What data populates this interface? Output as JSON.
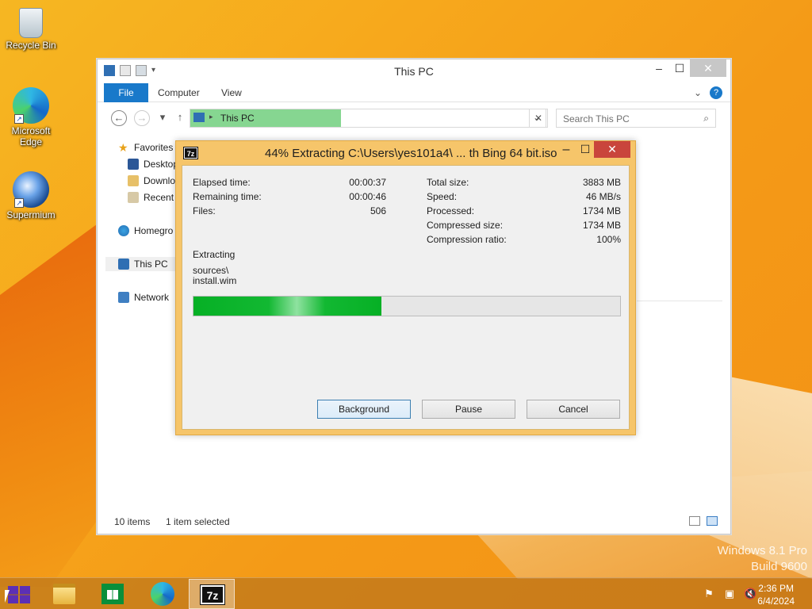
{
  "desktop": {
    "icons": [
      {
        "label": "Recycle Bin",
        "icon": "recycle-bin-icon"
      },
      {
        "label": "Microsoft Edge",
        "icon": "edge-icon"
      },
      {
        "label": "Supermium",
        "icon": "supermium-icon"
      }
    ],
    "watermark": {
      "line1": "Windows 8.1 Pro",
      "line2": "Build 9600"
    }
  },
  "explorer": {
    "title": "This PC",
    "tabs": {
      "file": "File",
      "computer": "Computer",
      "view": "View"
    },
    "address": "This PC",
    "search_placeholder": "Search This PC",
    "nav": {
      "favorites": "Favorites",
      "desktop": "Desktop",
      "downloads": "Downlo",
      "recent": "Recent p",
      "homegroup": "Homegro",
      "this_pc": "This PC",
      "network": "Network"
    },
    "status": {
      "items": "10 items",
      "selected": "1 item selected"
    }
  },
  "dialog": {
    "title": "44% Extracting C:\\Users\\yes101a4\\ ... th Bing 64 bit.iso",
    "progress_percent": 44,
    "left": [
      {
        "label": "Elapsed time:",
        "value": "00:00:37"
      },
      {
        "label": "Remaining time:",
        "value": "00:00:46"
      },
      {
        "label": "Files:",
        "value": "506"
      }
    ],
    "right": [
      {
        "label": "Total size:",
        "value": "3883 MB"
      },
      {
        "label": "Speed:",
        "value": "46 MB/s"
      },
      {
        "label": "Processed:",
        "value": "1734 MB"
      },
      {
        "label": "Compressed size:",
        "value": "1734 MB"
      },
      {
        "label": "Compression ratio:",
        "value": "100%"
      }
    ],
    "operation": "Extracting",
    "path_line1": "sources\\",
    "path_line2": "install.wim",
    "buttons": {
      "background": "Background",
      "pause": "Pause",
      "cancel": "Cancel"
    },
    "app_icon_text": "7z"
  },
  "taskbar": {
    "apps": [
      {
        "name": "File Explorer",
        "icon": "folder-icon"
      },
      {
        "name": "Store",
        "icon": "store-icon"
      },
      {
        "name": "Microsoft Edge",
        "icon": "edge-icon"
      },
      {
        "name": "7-Zip",
        "icon": "7zip-icon",
        "active": true
      }
    ],
    "time": "2:36 PM",
    "date": "6/4/2024"
  },
  "colors": {
    "progress": "#06b025",
    "dialog_frame": "#f6c56a",
    "close": "#c9453c",
    "file_tab": "#1979ca"
  }
}
